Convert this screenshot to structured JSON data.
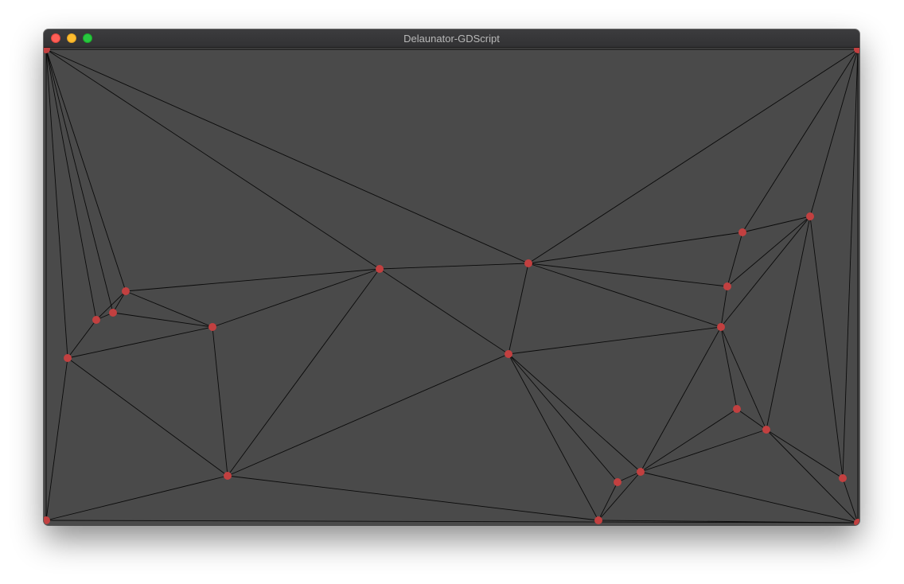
{
  "window": {
    "title": "Delaunator-GDScript"
  },
  "colors": {
    "background": "#4a4a4a",
    "edge": "#0a0a0a",
    "point": "#c24040"
  },
  "icons": {
    "close": "close-icon",
    "minimize": "minimize-icon",
    "zoom": "zoom-icon"
  }
}
